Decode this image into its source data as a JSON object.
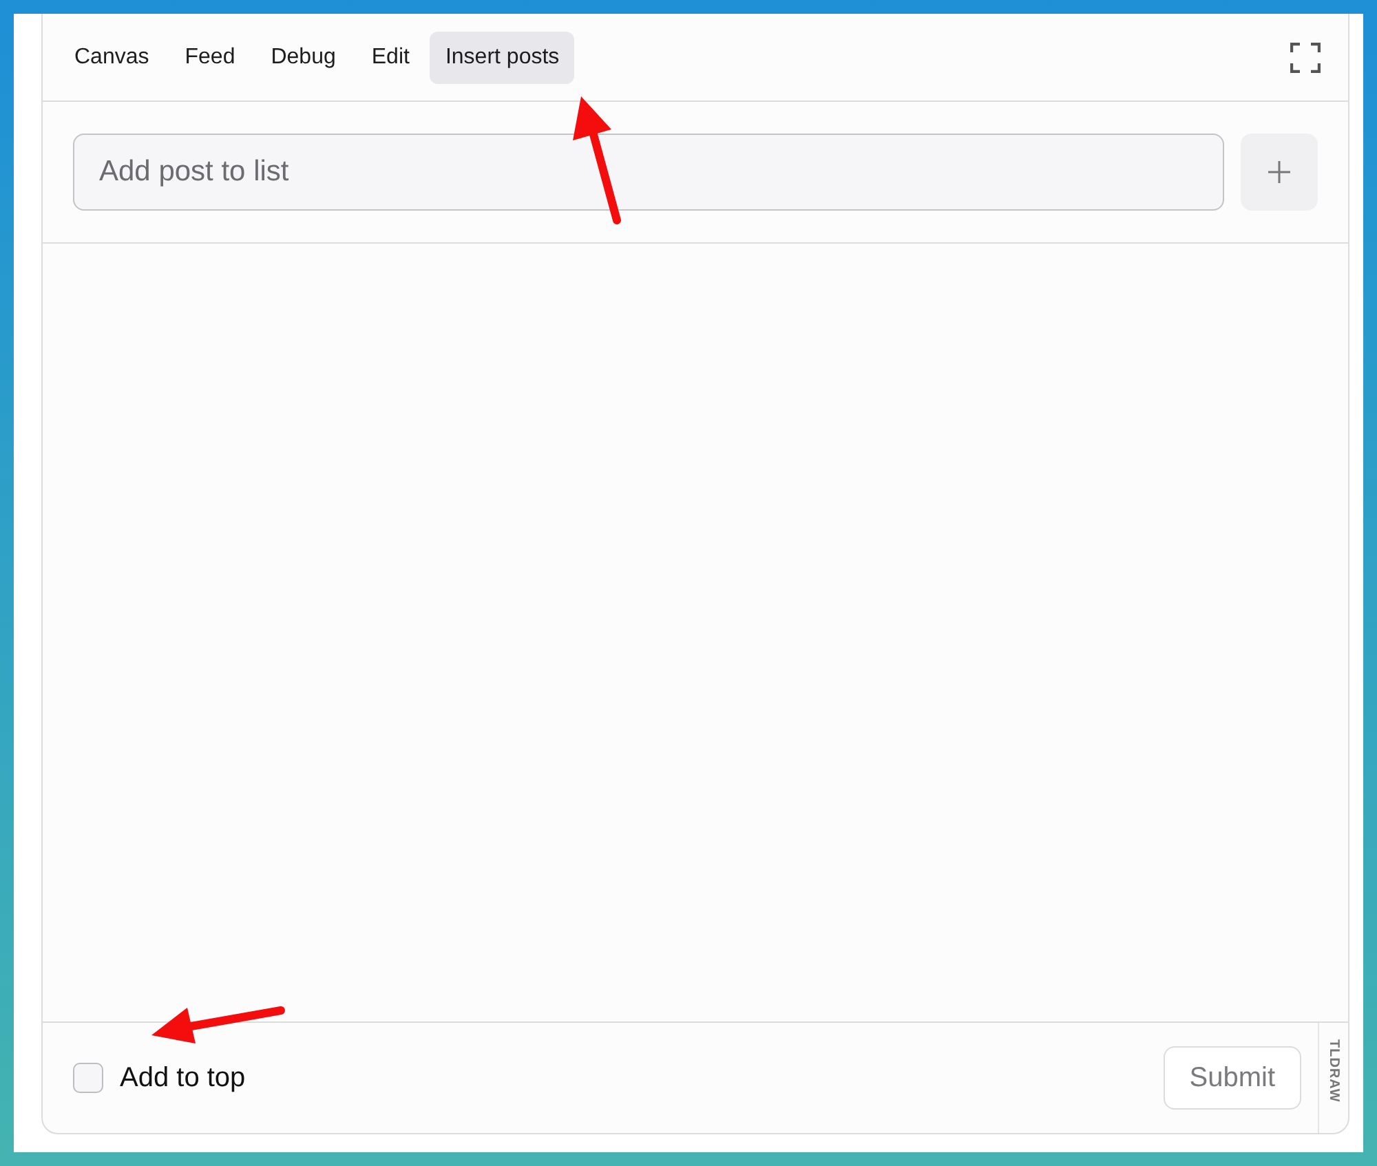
{
  "tabs": [
    {
      "label": "Canvas",
      "selected": false
    },
    {
      "label": "Feed",
      "selected": false
    },
    {
      "label": "Debug",
      "selected": false
    },
    {
      "label": "Edit",
      "selected": false
    },
    {
      "label": "Insert posts",
      "selected": true
    }
  ],
  "post_input": {
    "placeholder": "Add post to list"
  },
  "add_to_top": {
    "label": "Add to top",
    "checked": false
  },
  "submit": {
    "label": "Submit",
    "disabled": true
  },
  "side_label": "TLDRAW"
}
